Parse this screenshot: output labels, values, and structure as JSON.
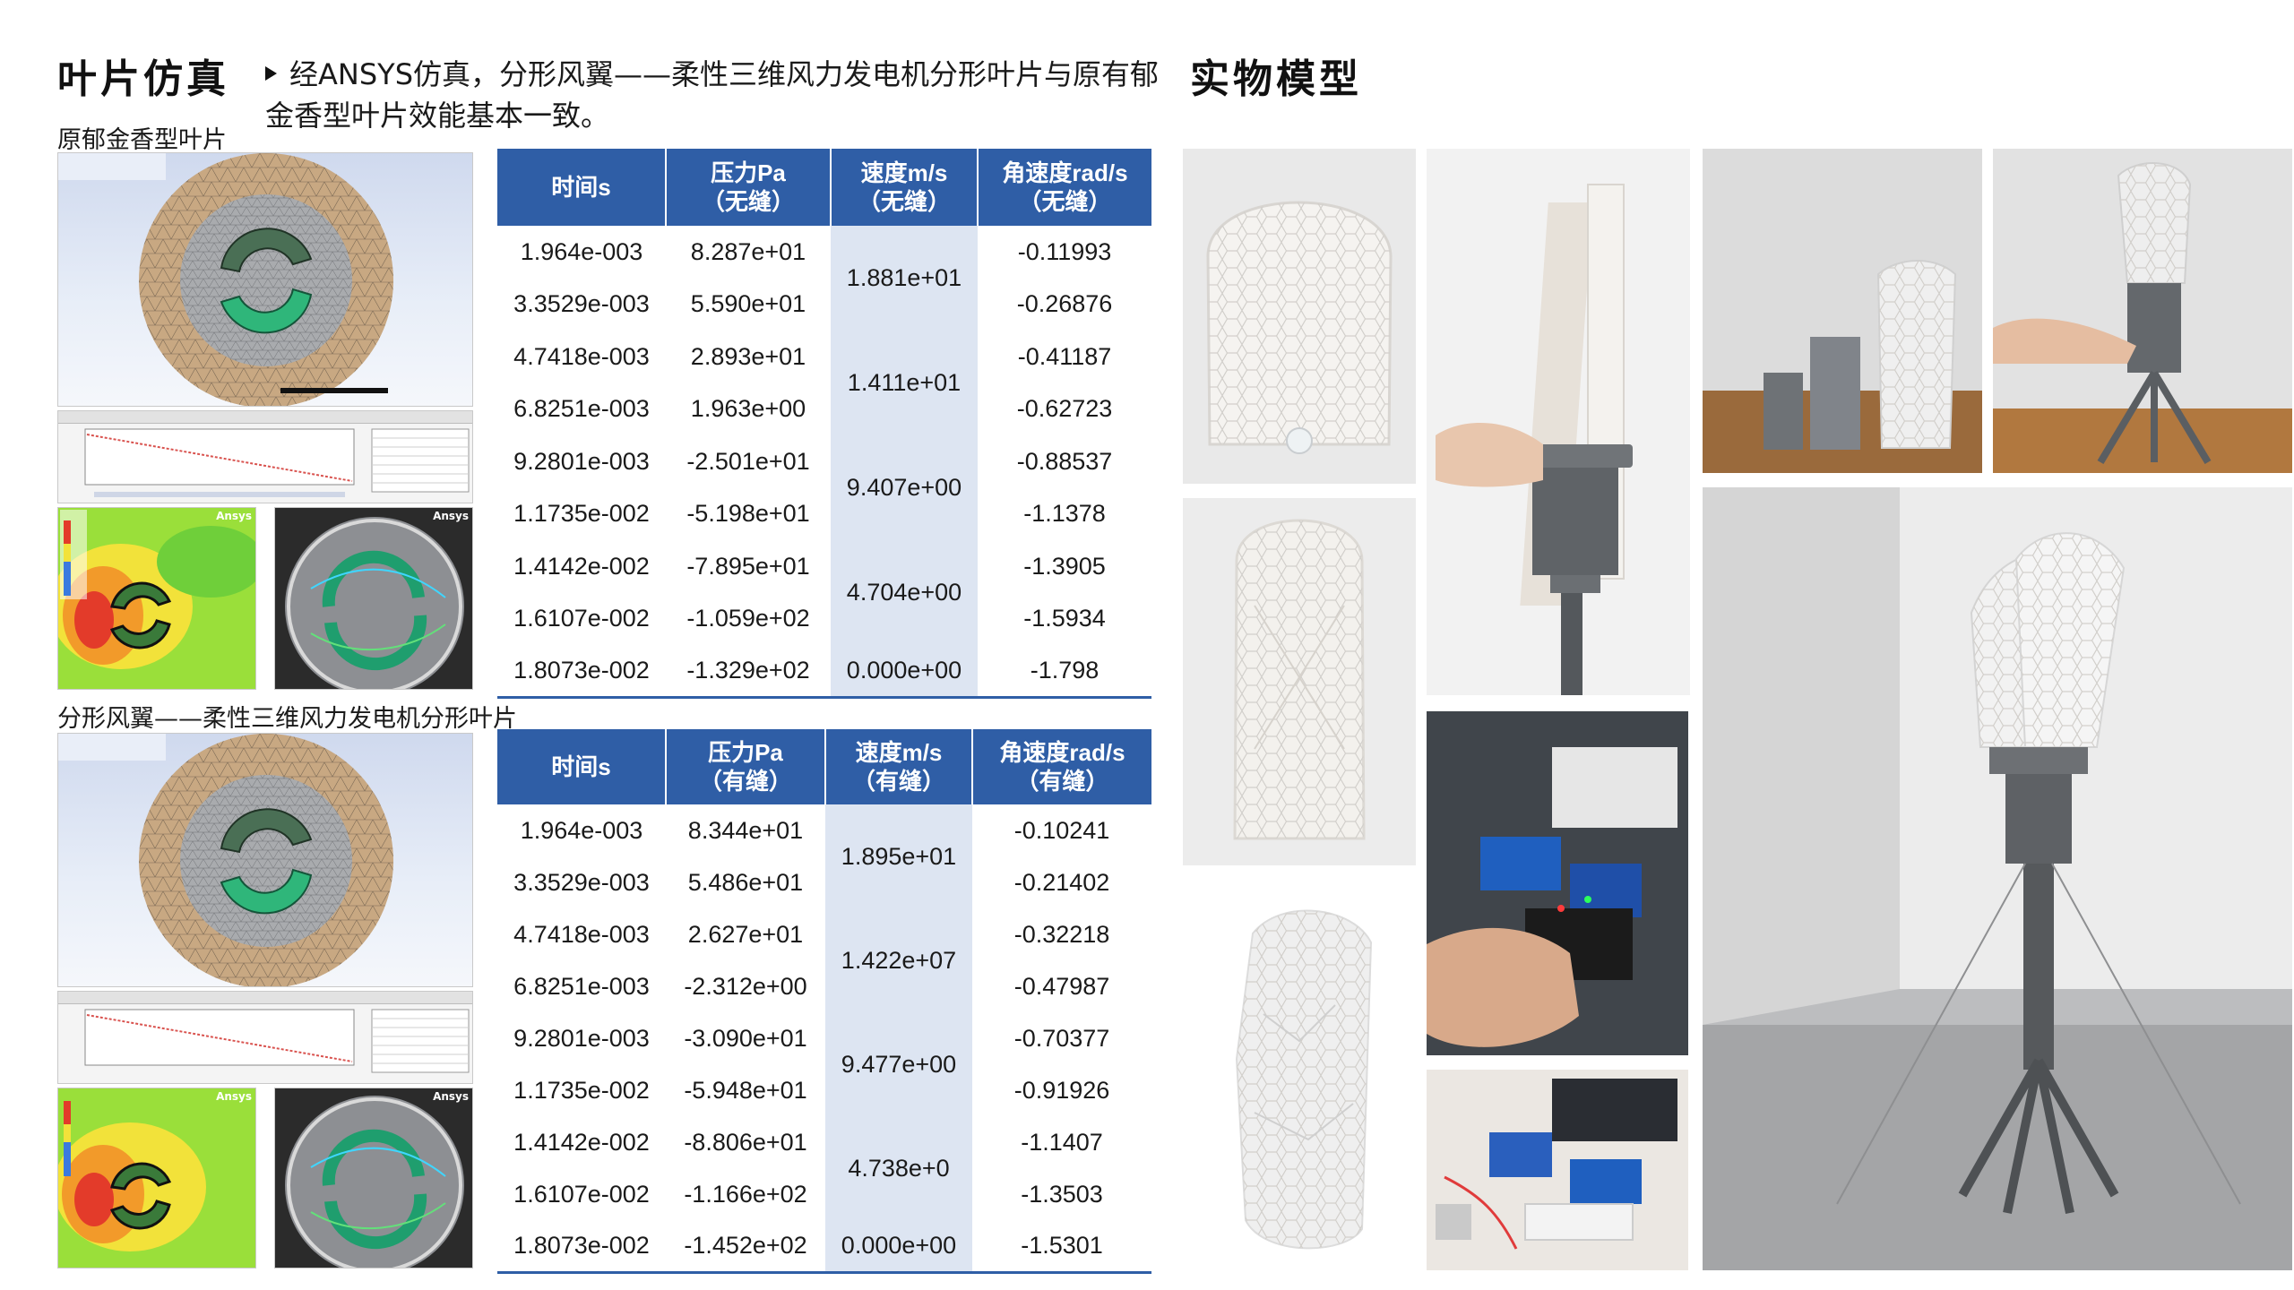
{
  "titles": {
    "simulation": "叶片仿真",
    "physical_model": "实物模型"
  },
  "description": "经ANSYS仿真，分形风翼——柔性三维风力发电机分形叶片与原有郁金香型叶片效能基本一致。",
  "sections": {
    "tulip": {
      "label": "原郁金香型叶片"
    },
    "fractal": {
      "label": "分形风翼——柔性三维风力发电机分形叶片"
    }
  },
  "tables": {
    "tulip": {
      "headers": {
        "time": "时间s",
        "pressure": "压力Pa",
        "pressure_sub": "（无缝）",
        "speed": "速度m/s",
        "speed_sub": "（无缝）",
        "angular": "角速度rad/s",
        "angular_sub": "（无缝）"
      },
      "rows": [
        {
          "time": "1.964e-003",
          "pressure": "8.287e+01",
          "angular": "-0.11993"
        },
        {
          "time": "3.3529e-003",
          "pressure": "5.590e+01",
          "angular": "-0.26876"
        },
        {
          "time": "4.7418e-003",
          "pressure": "2.893e+01",
          "angular": "-0.41187"
        },
        {
          "time": "6.8251e-003",
          "pressure": "1.963e+00",
          "angular": "-0.62723"
        },
        {
          "time": "9.2801e-003",
          "pressure": "-2.501e+01",
          "angular": "-0.88537"
        },
        {
          "time": "1.1735e-002",
          "pressure": "-5.198e+01",
          "angular": "-1.1378"
        },
        {
          "time": "1.4142e-002",
          "pressure": "-7.895e+01",
          "angular": "-1.3905"
        },
        {
          "time": "1.6107e-002",
          "pressure": "-1.059e+02",
          "angular": "-1.5934"
        },
        {
          "time": "1.8073e-002",
          "pressure": "-1.329e+02",
          "angular": "-1.798"
        }
      ],
      "speeds": [
        "1.881e+01",
        "1.411e+01",
        "9.407e+00",
        "4.704e+00",
        "0.000e+00"
      ]
    },
    "fractal": {
      "headers": {
        "time": "时间s",
        "pressure": "压力Pa",
        "pressure_sub": "（有缝）",
        "speed": "速度m/s",
        "speed_sub": "（有缝）",
        "angular": "角速度rad/s",
        "angular_sub": "（有缝）"
      },
      "rows": [
        {
          "time": "1.964e-003",
          "pressure": "8.344e+01",
          "angular": "-0.10241"
        },
        {
          "time": "3.3529e-003",
          "pressure": "5.486e+01",
          "angular": "-0.21402"
        },
        {
          "time": "4.7418e-003",
          "pressure": "2.627e+01",
          "angular": "-0.32218"
        },
        {
          "time": "6.8251e-003",
          "pressure": "-2.312e+00",
          "angular": "-0.47987"
        },
        {
          "time": "9.2801e-003",
          "pressure": "-3.090e+01",
          "angular": "-0.70377"
        },
        {
          "time": "1.1735e-002",
          "pressure": "-5.948e+01",
          "angular": "-0.91926"
        },
        {
          "time": "1.4142e-002",
          "pressure": "-8.806e+01",
          "angular": "-1.1407"
        },
        {
          "time": "1.6107e-002",
          "pressure": "-1.166e+02",
          "angular": "-1.3503"
        },
        {
          "time": "1.8073e-002",
          "pressure": "-1.452e+02",
          "angular": "-1.5301"
        }
      ],
      "speeds": [
        "1.895e+01",
        "1.422e+07",
        "9.477e+00",
        "4.738e+0",
        "0.000e+00"
      ]
    }
  },
  "sim_overlays": {
    "ansys_brand": "Ansys"
  },
  "colors": {
    "table_header": "#2f5ea6",
    "speed_column": "#dde5f2",
    "mesh_outer": "#c8a882",
    "mesh_inner": "#a9abae",
    "blade_green": "#2fb67a"
  }
}
